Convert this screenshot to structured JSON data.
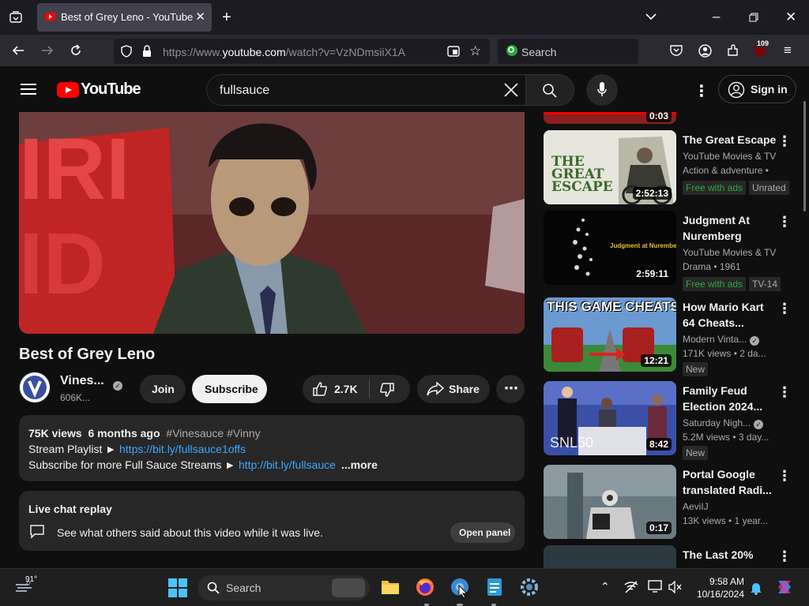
{
  "browser": {
    "tab_title": "Best of Grey Leno - YouTube",
    "url_prefix": "https://www.",
    "url_domain": "youtube.com",
    "url_path": "/watch?v=VzNDmsiiX1A",
    "search_placeholder": "Search",
    "extension_badge": "109"
  },
  "youtube": {
    "logo_text": "YouTube",
    "search_query": "fullsauce",
    "sign_in_label": "Sign in"
  },
  "video": {
    "title": "Best of Grey Leno",
    "channel_name": "Vines...",
    "subscribers": "606K...",
    "join_label": "Join",
    "subscribe_label": "Subscribe",
    "likes": "2.7K",
    "share_label": "Share",
    "more_options": "⋯"
  },
  "description": {
    "views": "75K views",
    "age": "6 months ago",
    "hashtags": "#Vinesauce #Vinny",
    "line2_text": "Stream Playlist ► ",
    "line2_link": "https://bit.ly/fullsauce1offs",
    "line3_text": "Subscribe for more Full Sauce Streams ► ",
    "line3_link": "http://bit.ly/fullsauce",
    "more_label": "...more"
  },
  "live_chat": {
    "title": "Live chat replay",
    "text": "See what others said about this video while it was live.",
    "button": "Open panel"
  },
  "sidebar": {
    "top_partial_duration": "0:03",
    "items": [
      {
        "title": "The Great Escape",
        "line1": "YouTube Movies & TV",
        "line2": "Action & adventure •",
        "duration": "2:52:13",
        "badge1": "Free with ads",
        "badge2": "Unrated",
        "thumb_text": "THE GREAT ESCAPE"
      },
      {
        "title": "Judgment At Nuremberg",
        "line1": "YouTube Movies & TV",
        "line2": "Drama • 1961",
        "duration": "2:59:11",
        "badge1": "Free with ads",
        "badge2": "TV-14",
        "thumb_text": "Judgment at Nuremberg"
      },
      {
        "title": "How Mario Kart 64 Cheats...",
        "line1": "Modern Vinta...",
        "line2": "171K views • 2 da...",
        "duration": "12:21",
        "badge1": "New",
        "thumb_text": "THIS GAME CHEATS!"
      },
      {
        "title": "Family Feud Election 2024...",
        "line1": "Saturday Nigh...",
        "line2": "5.2M views • 3 day...",
        "duration": "8:42",
        "badge1": "New",
        "thumb_text": "SNL50"
      },
      {
        "title": "Portal Google translated Radi...",
        "line1": "AeviIJ",
        "line2": "13K views • 1 year...",
        "duration": "0:17"
      },
      {
        "title": "The Last 20%"
      }
    ]
  },
  "taskbar": {
    "temperature": "91°",
    "search_label": "Search",
    "time": "9:58 AM",
    "date": "10/16/2024"
  },
  "colors": {
    "accent_red": "#ff0000",
    "link_blue": "#3ea6ff",
    "free_green": "#2ba640"
  }
}
